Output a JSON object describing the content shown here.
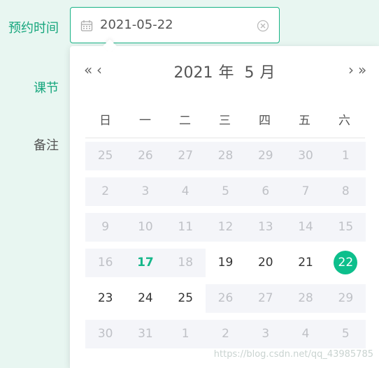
{
  "form": {
    "label_time": "预约时间",
    "label_section": "课节",
    "label_notes": "备注"
  },
  "date_input": {
    "value": "2021-05-22",
    "icons": [
      "calendar-icon",
      "clear-icon"
    ]
  },
  "picker": {
    "nav": {
      "prev_year": "«",
      "prev_month": "‹",
      "next_month": "›",
      "next_year": "»"
    },
    "header": {
      "year": "2021",
      "year_unit": "年",
      "month": "5",
      "month_unit": "月"
    },
    "weekdays": [
      "日",
      "一",
      "二",
      "三",
      "四",
      "五",
      "六"
    ],
    "weeks": [
      [
        "25",
        "26",
        "27",
        "28",
        "29",
        "30",
        "1"
      ],
      [
        "2",
        "3",
        "4",
        "5",
        "6",
        "7",
        "8"
      ],
      [
        "9",
        "10",
        "11",
        "12",
        "13",
        "14",
        "15"
      ],
      [
        "16",
        "17",
        "18",
        "19",
        "20",
        "21",
        "22"
      ],
      [
        "23",
        "24",
        "25",
        "26",
        "27",
        "28",
        "29"
      ],
      [
        "30",
        "31",
        "1",
        "2",
        "3",
        "4",
        "5"
      ]
    ],
    "today": "17",
    "selected": "22"
  },
  "watermark": "https://blog.csdn.net/qq_43985785",
  "colors": {
    "accent": "#0dbf8c",
    "background": "#e8f6f1"
  }
}
